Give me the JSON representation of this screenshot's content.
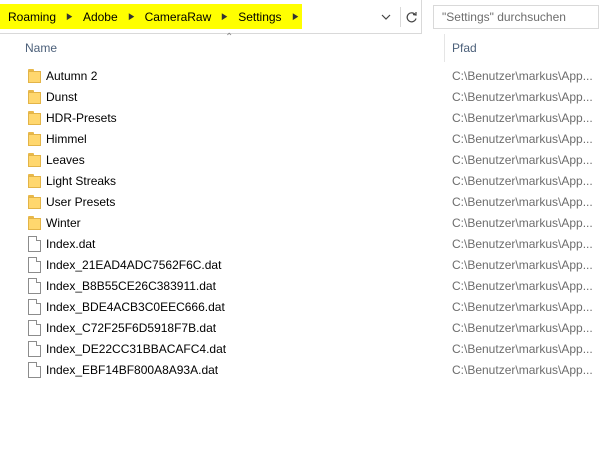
{
  "address": {
    "crumbs": [
      "Roaming",
      "Adobe",
      "CameraRaw",
      "Settings"
    ],
    "dropdown_icon": "chevron-down-icon",
    "refresh_icon": "refresh-icon"
  },
  "search": {
    "placeholder": "\"Settings\" durchsuchen"
  },
  "columns": {
    "name": "Name",
    "path": "Pfad"
  },
  "items": [
    {
      "type": "folder",
      "name": "Autumn 2",
      "path": "C:\\Benutzer\\markus\\App..."
    },
    {
      "type": "folder",
      "name": "Dunst",
      "path": "C:\\Benutzer\\markus\\App..."
    },
    {
      "type": "folder",
      "name": "HDR-Presets",
      "path": "C:\\Benutzer\\markus\\App..."
    },
    {
      "type": "folder",
      "name": "Himmel",
      "path": "C:\\Benutzer\\markus\\App..."
    },
    {
      "type": "folder",
      "name": "Leaves",
      "path": "C:\\Benutzer\\markus\\App..."
    },
    {
      "type": "folder",
      "name": "Light Streaks",
      "path": "C:\\Benutzer\\markus\\App..."
    },
    {
      "type": "folder",
      "name": "User Presets",
      "path": "C:\\Benutzer\\markus\\App..."
    },
    {
      "type": "folder",
      "name": "Winter",
      "path": "C:\\Benutzer\\markus\\App..."
    },
    {
      "type": "file",
      "name": "Index.dat",
      "path": "C:\\Benutzer\\markus\\App..."
    },
    {
      "type": "file",
      "name": "Index_21EAD4ADC7562F6C.dat",
      "path": "C:\\Benutzer\\markus\\App..."
    },
    {
      "type": "file",
      "name": "Index_B8B55CE26C383911.dat",
      "path": "C:\\Benutzer\\markus\\App..."
    },
    {
      "type": "file",
      "name": "Index_BDE4ACB3C0EEC666.dat",
      "path": "C:\\Benutzer\\markus\\App..."
    },
    {
      "type": "file",
      "name": "Index_C72F25F6D5918F7B.dat",
      "path": "C:\\Benutzer\\markus\\App..."
    },
    {
      "type": "file",
      "name": "Index_DE22CC31BBACAFC4.dat",
      "path": "C:\\Benutzer\\markus\\App..."
    },
    {
      "type": "file",
      "name": "Index_EBF14BF800A8A93A.dat",
      "path": "C:\\Benutzer\\markus\\App..."
    }
  ],
  "colors": {
    "highlight": "#ffff00",
    "header_text": "#4c607a",
    "path_text": "#6d6d6d"
  }
}
